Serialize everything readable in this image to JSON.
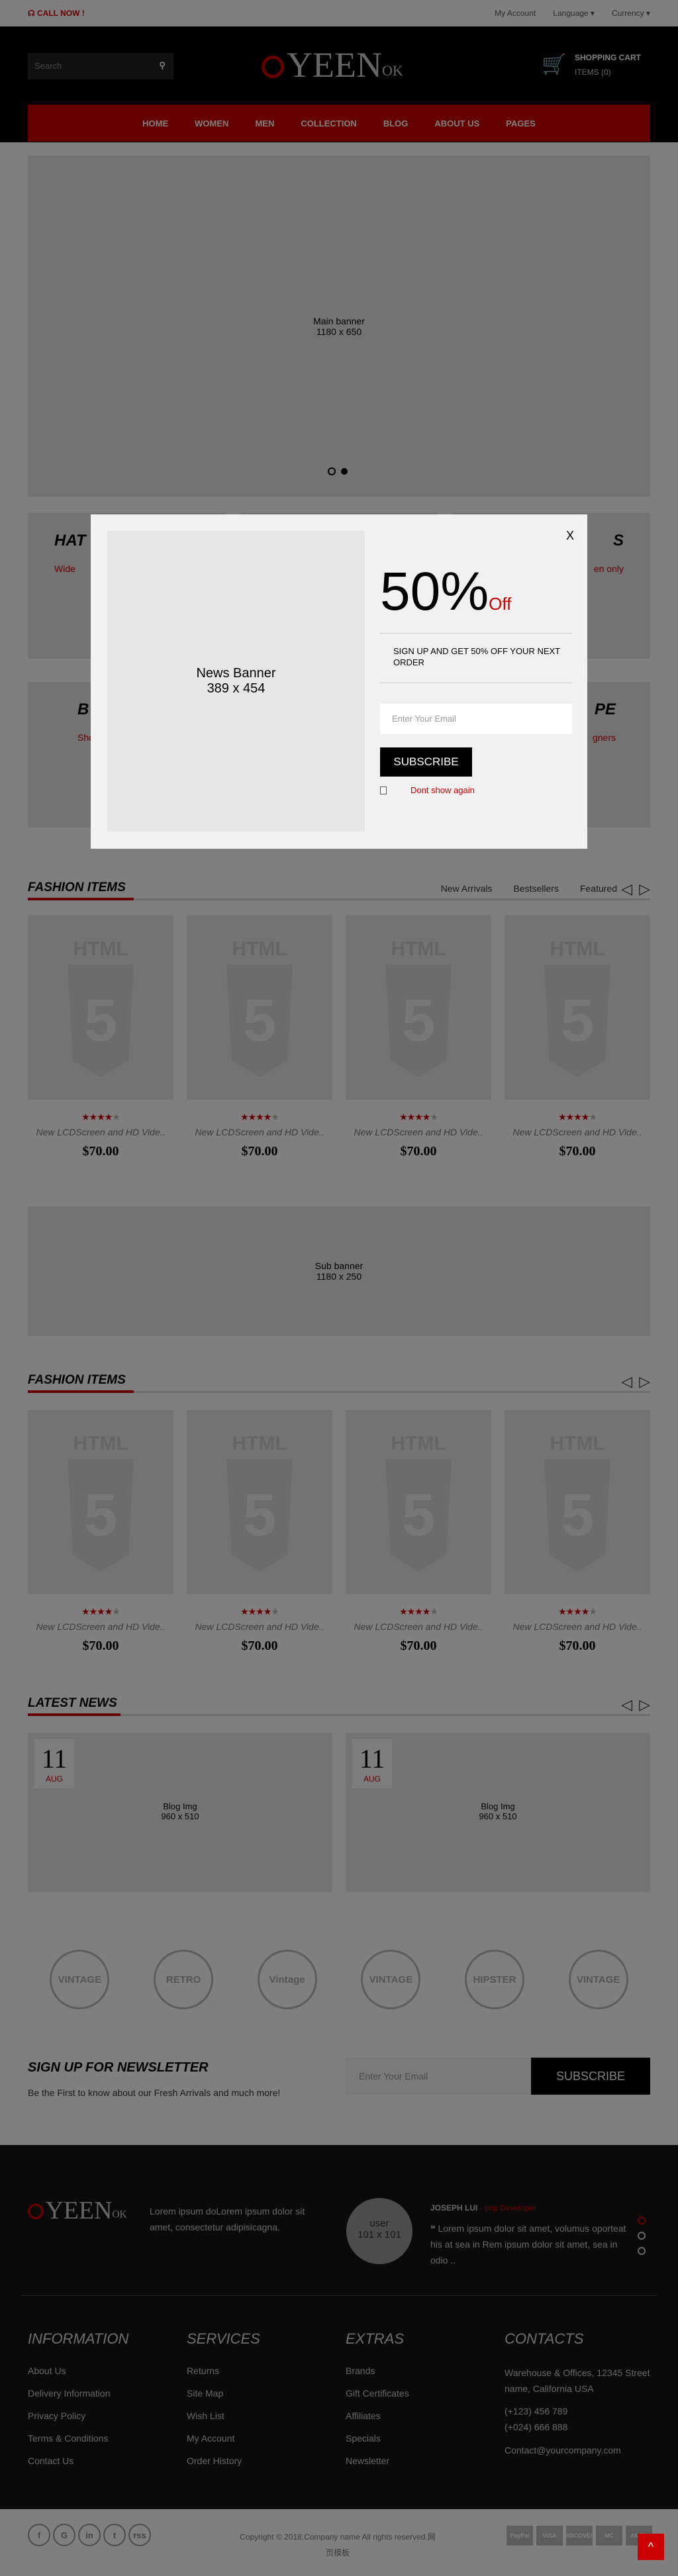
{
  "topbar": {
    "call": "CALL NOW !",
    "links": [
      "My Account",
      "Language",
      "Currency"
    ]
  },
  "header": {
    "search_placeholder": "Search",
    "logo": {
      "main": "YEEN",
      "suffix": "OK"
    },
    "cart": {
      "title": "SHOPPING CART",
      "items": "ITEMS (0)"
    }
  },
  "nav": [
    "HOME",
    "WOMEN",
    "MEN",
    "COLLECTION",
    "BLOG",
    "ABOUT US",
    "PAGES"
  ],
  "banner": {
    "line1": "Main banner",
    "line2": "1180 x 650",
    "slides": 2,
    "active_slide": 2
  },
  "categories": [
    {
      "title": "HAT",
      "sub": "Wide"
    },
    {
      "title": "",
      "sub": ""
    },
    {
      "title": "S",
      "sub": "en only"
    },
    {
      "title": "B",
      "sub": "Shop"
    },
    {
      "title": "",
      "sub": ""
    },
    {
      "title": "PE",
      "sub": "gners"
    }
  ],
  "section1": {
    "title": "FASHION ITEMS",
    "tabs": [
      "New Arrivals",
      "Bestsellers",
      "Featured"
    ]
  },
  "section2": {
    "title": "FASHION ITEMS"
  },
  "product": {
    "name": "New LCDScreen and HD Vide..",
    "price": "$70.00",
    "rating": 4,
    "max_rating": 5,
    "placeholder": "HTML",
    "placeholder_num": "5"
  },
  "sub_banner": {
    "line1": "Sub banner",
    "line2": "1180 x 250"
  },
  "news": {
    "title": "LATEST NEWS",
    "posts": [
      {
        "day": "11",
        "month": "AUG",
        "cap1": "Blog Img",
        "cap2": "960 x 510"
      },
      {
        "day": "11",
        "month": "AUG",
        "cap1": "Blog Img",
        "cap2": "960 x 510"
      }
    ]
  },
  "brands": [
    "VINTAGE",
    "RETRO",
    "Vintage",
    "VINTAGE",
    "HIPSTER",
    "VINTAGE"
  ],
  "newsletter": {
    "title": "SIGN UP FOR NEWSLETTER",
    "text": "Be the First to know about our Fresh Arrivals and much more!",
    "placeholder": "Enter Your Email",
    "button": "SUBSCRIBE"
  },
  "footer": {
    "about": "Lorem ipsum doLorem ipsum dolor sit amet, consectetur adipisicagna.",
    "avatar1": "user",
    "avatar2": "101 x 101",
    "testimonial": {
      "name": "JOSEPH LUI",
      "role": "- php Developer",
      "quote": "Lorem ipsum dolor sit amet, volumus oporteat his at sea in Rem ipsum dolor sit amet, sea in odio .."
    },
    "columns": [
      {
        "title": "INFORMATION",
        "links": [
          "About Us",
          "Delivery Information",
          "Privacy Policy",
          "Terms & Conditions",
          "Contact Us"
        ]
      },
      {
        "title": "SERVICES",
        "links": [
          "Returns",
          "Site Map",
          "Wish List",
          "My Account",
          "Order History"
        ]
      },
      {
        "title": "EXTRAS",
        "links": [
          "Brands",
          "Gift Certificates",
          "Affiliates",
          "Specials",
          "Newsletter"
        ]
      }
    ],
    "contacts": {
      "title": "CONTACTS",
      "address": "Warehouse & Offices, 12345 Street name, California USA",
      "phone1": "(+123) 456 789",
      "phone2": "(+024) 666 888",
      "email": "Contact@yourcompany.com"
    }
  },
  "bottom": {
    "social": [
      "f",
      "G",
      "in",
      "t",
      "rss"
    ],
    "copyright": "Copyright © 2018.Company name All rights reserved.网页模板",
    "payments": [
      "PayPal",
      "VISA",
      "DISCOVER",
      "MC",
      "AMEX"
    ]
  },
  "modal": {
    "img1": "News Banner",
    "img2": "389 x 454",
    "close": "X",
    "big": "50%",
    "off": "Off",
    "text": "SIGN UP AND GET 50% OFF YOUR NEXT ORDER",
    "placeholder": "Enter Your Email",
    "button": "SUBSCRIBE",
    "dont_show": "Dont show again"
  },
  "colors": {
    "accent": "#cc0000",
    "dark": "#000000",
    "footer": "#151515"
  }
}
